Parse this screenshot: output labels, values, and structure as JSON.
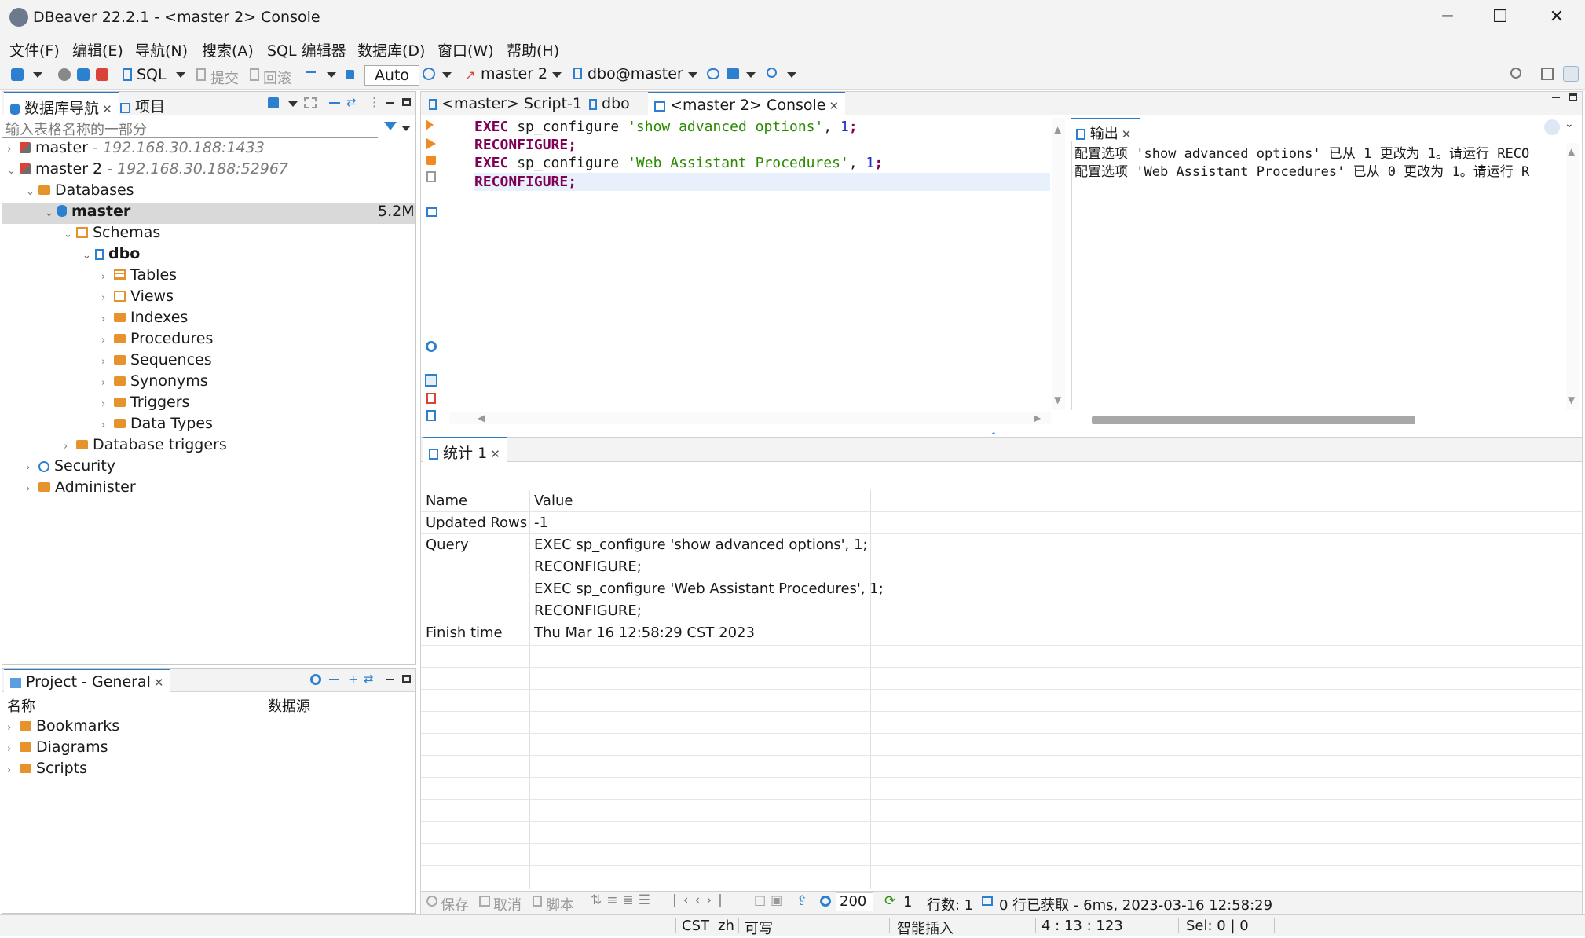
{
  "window": {
    "title": "DBeaver 22.2.1 - <master 2> Console",
    "minimize": "─",
    "maximize": "☐",
    "close": "✕"
  },
  "menu": [
    "文件(F)",
    "编辑(E)",
    "导航(N)",
    "搜索(A)",
    "SQL 编辑器",
    "数据库(D)",
    "窗口(W)",
    "帮助(H)"
  ],
  "toolbar": {
    "sql": "SQL",
    "commit": "提交",
    "rollback": "回滚",
    "auto": "Auto",
    "datasource": "master 2",
    "schema": "dbo@master"
  },
  "navigator": {
    "tab_label": "数据库导航",
    "projects_tab": "项目",
    "filter_placeholder": "输入表格名称的一部分",
    "tree": {
      "conn1": {
        "name": "master",
        "host": "- 192.168.30.188:1433"
      },
      "conn2": {
        "name": "master 2",
        "host": "- 192.168.30.188:52967"
      },
      "databases": "Databases",
      "master_db": {
        "name": "master",
        "size": "5.2M"
      },
      "schemas": "Schemas",
      "dbo": "dbo",
      "items": [
        "Tables",
        "Views",
        "Indexes",
        "Procedures",
        "Sequences",
        "Synonyms",
        "Triggers",
        "Data Types"
      ],
      "db_triggers": "Database triggers",
      "security": "Security",
      "administer": "Administer"
    }
  },
  "project": {
    "tab_label": "Project - General",
    "col_name": "名称",
    "col_source": "数据源",
    "items": [
      "Bookmarks",
      "Diagrams",
      "Scripts"
    ]
  },
  "editor": {
    "tabs": [
      "<master> Script-1",
      "dbo",
      "<master 2> Console"
    ],
    "lines": [
      {
        "kw": "EXEC",
        "fn": " sp_configure ",
        "str": "'show advanced options'",
        "sep": ", ",
        "num": "1",
        "end": ";"
      },
      {
        "kw": "RECONFIGURE",
        "fn": "",
        "str": "",
        "sep": "",
        "num": "",
        "end": ";"
      },
      {
        "kw": "EXEC",
        "fn": " sp_configure ",
        "str": "'Web Assistant Procedures'",
        "sep": ", ",
        "num": "1",
        "end": ";"
      },
      {
        "kw": "RECONFIGURE",
        "fn": "",
        "str": "",
        "sep": "",
        "num": "",
        "end": ";"
      }
    ]
  },
  "output": {
    "tab_label": "输出",
    "lines": [
      "配置选项 'show advanced options' 已从 1 更改为 1。请运行 RECO",
      "配置选项 'Web Assistant Procedures' 已从 0 更改为 1。请运行 R"
    ]
  },
  "stats": {
    "tab_label": "统计 1",
    "header": {
      "name": "Name",
      "value": "Value"
    },
    "rows": [
      {
        "name": "Updated Rows",
        "value": "-1"
      },
      {
        "name": "Query",
        "value": "EXEC sp_configure 'show advanced options', 1;"
      },
      {
        "name": "",
        "value": "RECONFIGURE;"
      },
      {
        "name": "",
        "value": "EXEC sp_configure 'Web Assistant Procedures', 1;"
      },
      {
        "name": "",
        "value": "RECONFIGURE;"
      },
      {
        "name": "Finish time",
        "value": "Thu Mar 16 12:58:29 CST 2023"
      }
    ]
  },
  "results_toolbar": {
    "save": "保存",
    "cancel": "取消",
    "script": "脚本",
    "fetch_size": "200",
    "refresh_count": "1",
    "row_count": "行数: 1",
    "fetch_info": "0 行已获取 - 6ms, 2023-03-16 12:58:29"
  },
  "statusbar": {
    "tz": "CST",
    "lang": "zh",
    "mode": "可写",
    "insert": "智能插入",
    "position": "4 : 13 : 123",
    "selection": "Sel: 0 | 0"
  }
}
